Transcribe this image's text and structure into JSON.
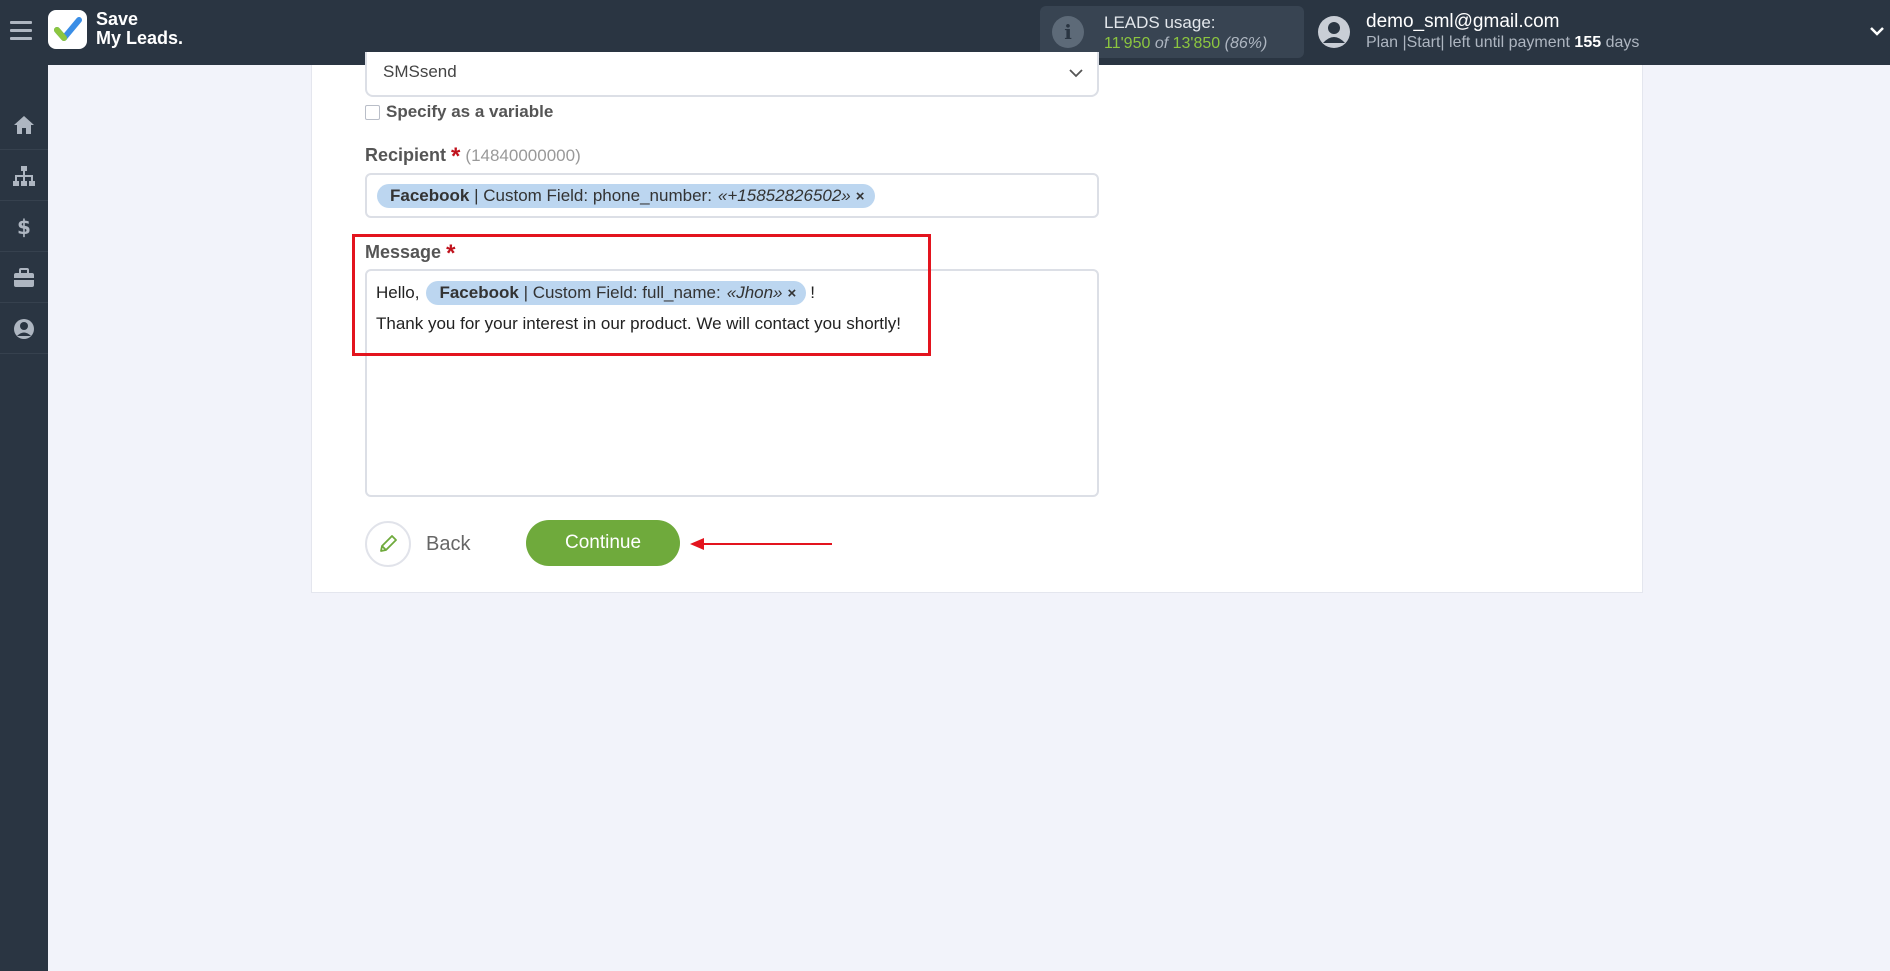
{
  "app": {
    "logo_line1": "Save",
    "logo_line2": "My Leads."
  },
  "usage": {
    "title": "LEADS usage:",
    "used": "11'950",
    "of_word": "of",
    "total": "13'850",
    "percent": "(86%)"
  },
  "user": {
    "email": "demo_sml@gmail.com",
    "plan_prefix": "Plan |Start| left until payment",
    "days": "155",
    "days_suffix": "days"
  },
  "sidebar": {
    "icons": [
      "home-icon",
      "sitemap-icon",
      "dollar-icon",
      "briefcase-icon",
      "user-circle-icon"
    ]
  },
  "form": {
    "select_value": "SMSsend",
    "specify_variable_label": "Specify as a variable",
    "recipient": {
      "label": "Recipient",
      "required_mark": "*",
      "hint": "(14840000000)",
      "tag_source": "Facebook",
      "tag_field": "| Custom Field: phone_number:",
      "tag_value": "«+15852826502»",
      "tag_remove": "×"
    },
    "message": {
      "label": "Message",
      "required_mark": "*",
      "text_before": "Hello,",
      "tag_source": "Facebook",
      "tag_field": "| Custom Field: full_name:",
      "tag_value": "«Jhon»",
      "tag_remove": "×",
      "text_after": "!",
      "line2": "Thank you for your interest in our product. We will contact you shortly!"
    },
    "back_label": "Back",
    "continue_label": "Continue"
  },
  "colors": {
    "topbar": "#2a3542",
    "accent_green": "#6faa3c",
    "highlight_red": "#e3141e",
    "tag_blue": "#bcd6f0"
  }
}
